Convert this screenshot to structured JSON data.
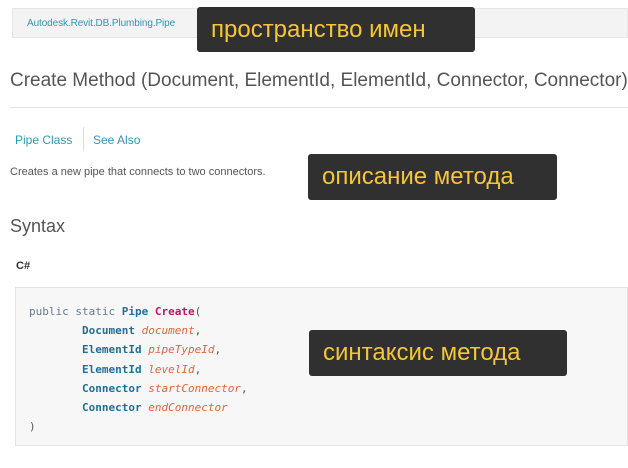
{
  "breadcrumb": {
    "namespace": "Autodesk.Revit.DB.Plumbing.Pipe"
  },
  "callouts": {
    "namespace": "пространство имен",
    "description": "описание метода",
    "syntax": "синтаксис метода"
  },
  "page": {
    "title": "Create Method (Document, ElementId, ElementId, Connector, Connector)",
    "description": "Creates a new pipe that connects to two connectors."
  },
  "tabs": [
    {
      "label": "Pipe Class"
    },
    {
      "label": "See Also"
    }
  ],
  "syntax": {
    "heading": "Syntax",
    "language": "C#",
    "modifiers": "public static",
    "return_type": "Pipe",
    "method": "Create",
    "open": "(",
    "close": ")",
    "params": [
      {
        "type": "Document",
        "name": "document",
        "sep": ","
      },
      {
        "type": "ElementId",
        "name": "pipeTypeId",
        "sep": ","
      },
      {
        "type": "ElementId",
        "name": "levelId",
        "sep": ","
      },
      {
        "type": "Connector",
        "name": "startConnector",
        "sep": ","
      },
      {
        "type": "Connector",
        "name": "endConnector",
        "sep": ""
      }
    ]
  },
  "colors": {
    "link": "#2f97b8",
    "callout_bg": "#303030",
    "callout_text": "#f6c637",
    "code_type": "#1f6f99",
    "code_method": "#c2185b",
    "code_param": "#e0653a"
  }
}
